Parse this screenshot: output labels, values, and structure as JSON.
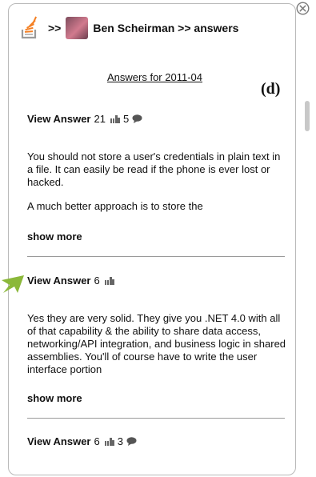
{
  "header": {
    "separator": ">>",
    "user_breadcrumb": "Ben Scheirman >> answers"
  },
  "answers_for_link": "Answers for 2011-04",
  "figure_label": "(d)",
  "answers": [
    {
      "view_label": "View Answer",
      "score": "21",
      "comments": "5",
      "text_lines": [
        "You should not store a user's credentials in plain text in a file. It can easily be read if the phone is ever lost or hacked.",
        "A much better approach is to store the"
      ],
      "show_more": "show more"
    },
    {
      "view_label": "View Answer",
      "score": "6",
      "text": "Yes they are very solid. They give you .NET 4.0 with all of that capability & the ability to share data access, networking/API integration, and business logic in shared assemblies. You'll of course have to write the user interface portion",
      "show_more": "show more"
    },
    {
      "view_label": "View Answer",
      "score": "6",
      "comments": "3"
    }
  ],
  "colors": {
    "arrow": "#8bb83a",
    "logo_orange": "#f48024",
    "divider": "#9a9a9a"
  },
  "icons": [
    "stackoverflow-logo-icon",
    "close-icon",
    "thumbs-up-icon",
    "comment-icon",
    "arrow-pointer-icon"
  ]
}
